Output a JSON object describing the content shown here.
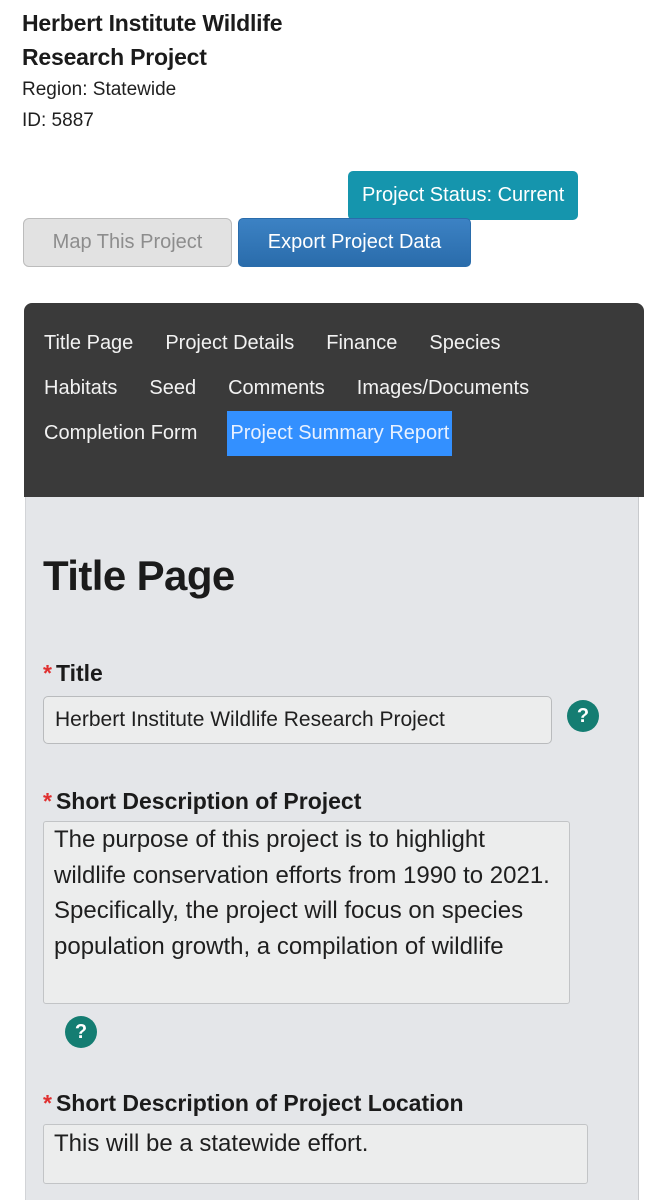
{
  "header": {
    "project_title": "Herbert Institute Wildlife Research Project",
    "region_line": "Region: Statewide",
    "id_line": "ID: 5887"
  },
  "status": {
    "badge_label": "Project Status: Current",
    "badge_color": "#1595ad"
  },
  "actions": {
    "map_button": "Map This Project",
    "export_button": "Export Project Data",
    "export_color": "#2e75b6"
  },
  "nav": {
    "items": [
      {
        "label": "Title Page",
        "selected": false
      },
      {
        "label": "Project Details",
        "selected": false
      },
      {
        "label": "Finance",
        "selected": false
      },
      {
        "label": "Species",
        "selected": false
      },
      {
        "label": "Habitats",
        "selected": false
      },
      {
        "label": "Seed",
        "selected": false
      },
      {
        "label": "Comments",
        "selected": false
      },
      {
        "label": "Images/Documents",
        "selected": false
      },
      {
        "label": "Completion Form",
        "selected": false
      },
      {
        "label": "Project Summary Report",
        "selected": true
      }
    ],
    "background_color": "#3a3a3a",
    "selected_color": "#3390ff"
  },
  "panel": {
    "heading": "Title Page",
    "required_marker": "*",
    "help_glyph": "?",
    "fields": {
      "title": {
        "label": "Title",
        "value": "Herbert Institute Wildlife Research Project",
        "placeholder": ""
      },
      "short_description": {
        "label": "Short Description of Project",
        "value": "The purpose of this project is to highlight wildlife conservation efforts from 1990 to 2021. Specifically, the project will focus on species population growth, a compilation of wildlife",
        "placeholder": ""
      },
      "short_description_location": {
        "label": "Short Description of Project Location",
        "value": "This will be a statewide effort.",
        "placeholder": ""
      }
    }
  }
}
